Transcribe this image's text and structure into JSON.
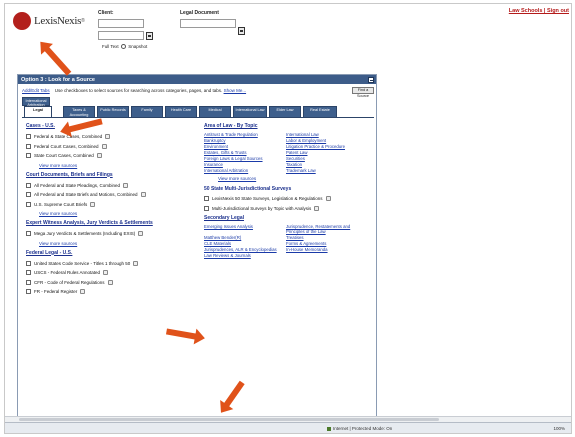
{
  "header": {
    "logo_text": "LexisNexis",
    "logo_mark": "®",
    "client_label": "Client:",
    "legal_document_label": "Legal Document",
    "full_text_label": "Full Text",
    "snapshot_label": "Snapshot",
    "top_links": "Law Schools | Sign out"
  },
  "panel": {
    "title": "Option 3 : Look for a Source",
    "intro_link": "Add/Edit Tabs",
    "intro_text": "Use checkboxes to select sources for searching across categories, pages, and tabs.",
    "intro_link2": "Show Me...",
    "intro_button": "Find a Source"
  },
  "tabs": {
    "top": "International Arbitration",
    "items": [
      "Legal",
      "Taxes & Accounting",
      "Public Records",
      "Family",
      "Health Care",
      "Medical",
      "International Law",
      "Elder Law",
      "Real Estate"
    ]
  },
  "left": {
    "cases_heading": "Cases - U.S.",
    "cases": [
      "Federal & State Cases, Combined",
      "Federal Court Cases, Combined",
      "State Court Cases, Combined"
    ],
    "view_more": "View more sources",
    "court_heading": "Court Documents, Briefs and Filings",
    "court": [
      "All Federal and State Pleadings, Combined",
      "All Federal and State Briefs and Motions, Combined",
      "U.S. Supreme Court Briefs"
    ],
    "expert_heading": "Expert Witness Analysis, Jury Verdicts & Settlements",
    "expert": [
      "Mega Jury Verdicts & Settlements (Including EXIS)"
    ],
    "federal_heading": "Federal Legal - U.S.",
    "federal": [
      "United States Code Service - Titles 1 through 50",
      "USCS - Federal Rules Annotated",
      "CFR - Code of Federal Regulations",
      "FR - Federal Register"
    ]
  },
  "right": {
    "area_heading": "Area of Law - By Topic",
    "area_links": [
      "Antitrust & Trade Regulation",
      "Bankruptcy",
      "Environment",
      "Estates, Gifts & Trusts",
      "Foreign Laws & Legal Sources",
      "Insurance",
      "International Arbitration",
      "International Law",
      "Labor & Employment",
      "Litigation Practice & Procedure",
      "Patent Law",
      "Securities",
      "Taxation",
      "Trademark Law"
    ],
    "view_more": "View more sources",
    "multi_heading": "50 State Multi-Jurisdictional Surveys",
    "multi": [
      "LexisNexis 50 State Surveys, Legislation & Regulations",
      "Multi-Jurisdictional Surveys by Topic with Analysis"
    ],
    "secondary_heading": "Secondary Legal",
    "secondary_links": [
      "Emerging Issues Analysis",
      "Matthew Bender(R)",
      "CLE Materials",
      "Jurisprudences, ALR & Encyclopedias",
      "Law Reviews & Journals",
      "Jurisprudence, Restatements and Principles of the Law",
      "Treatises",
      "Forms & Agreements",
      "In-House Memoranda"
    ]
  },
  "status": {
    "zone": "Internet | Protected Mode: On",
    "zoom": "100%"
  },
  "colors": {
    "accent": "#3e5f8c",
    "link": "#1a3aa8",
    "arrow": "#e0521a",
    "brand": "#b3201c"
  }
}
